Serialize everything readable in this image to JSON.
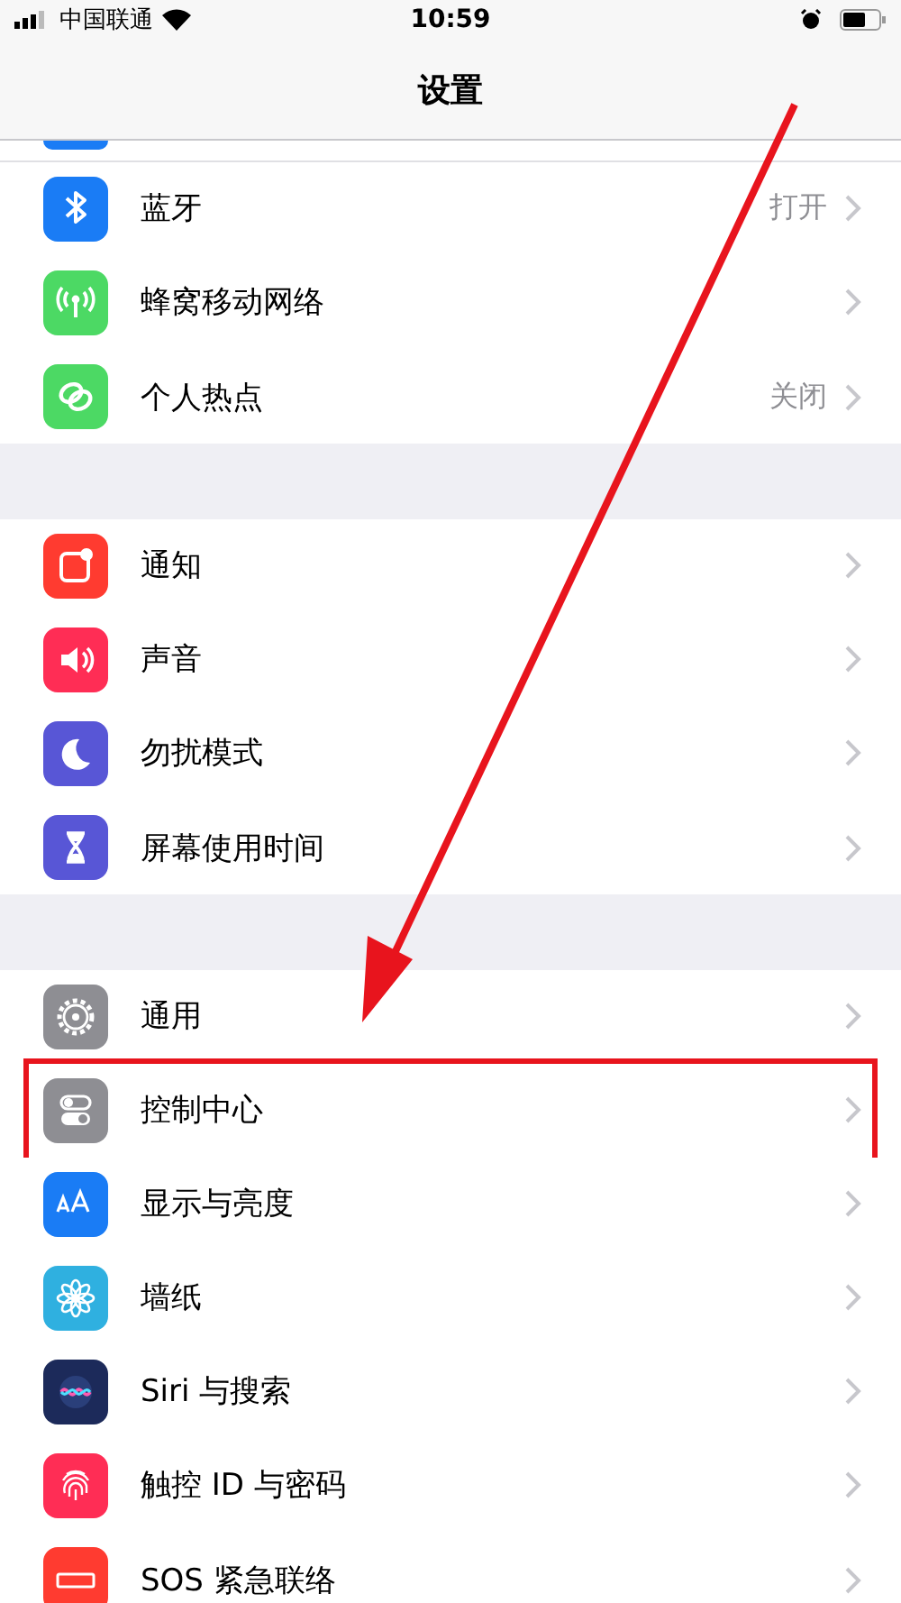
{
  "status_bar": {
    "carrier": "中国联通",
    "time": "10:59"
  },
  "nav": {
    "title": "设置"
  },
  "groups": [
    {
      "partial_top": true,
      "color": "#1a7cf5",
      "items": [
        {
          "label": "蓝牙",
          "value": "打开",
          "kind": "bluetooth",
          "color": "#1a7cf5",
          "highlighted": false
        },
        {
          "label": "蜂窝移动网络",
          "kind": "antenna",
          "color": "#4cd964",
          "highlighted": false
        },
        {
          "label": "个人热点",
          "value": "关闭",
          "kind": "link",
          "color": "#4cd964",
          "highlighted": false
        }
      ]
    },
    {
      "items": [
        {
          "label": "通知",
          "kind": "notify",
          "color": "#ff3b30",
          "highlighted": false
        },
        {
          "label": "声音",
          "kind": "speaker",
          "color": "#ff2d55",
          "highlighted": false
        },
        {
          "label": "勿扰模式",
          "kind": "moon",
          "color": "#5856d6",
          "highlighted": false
        },
        {
          "label": "屏幕使用时间",
          "kind": "hourglass",
          "color": "#5856d6",
          "highlighted": false
        }
      ]
    },
    {
      "items": [
        {
          "label": "通用",
          "kind": "gear",
          "color": "#8e8e93",
          "highlighted": false
        },
        {
          "label": "控制中心",
          "kind": "toggles",
          "color": "#8e8e93",
          "highlighted": true
        },
        {
          "label": "显示与亮度",
          "kind": "aa",
          "color": "#1a7cf5",
          "highlighted": false
        },
        {
          "label": "墙纸",
          "kind": "flower",
          "color": "#2fb0e0",
          "highlighted": false
        },
        {
          "label": "Siri 与搜索",
          "kind": "siri",
          "color": "#1c2a5a",
          "highlighted": false
        },
        {
          "label": "触控 ID 与密码",
          "kind": "fingerprint",
          "color": "#ff2d55",
          "highlighted": false
        },
        {
          "label": "SOS 紧急联络",
          "kind": "sos",
          "color": "#ff3b30",
          "highlighted": false
        }
      ]
    }
  ]
}
